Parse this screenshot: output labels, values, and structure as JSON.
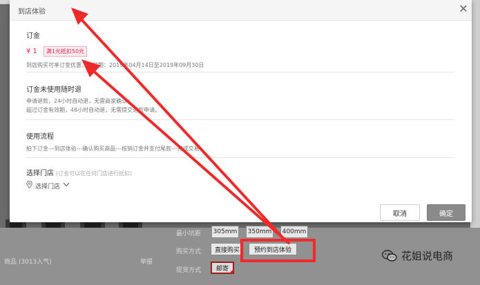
{
  "colors": {
    "accent_red": "#e0244a",
    "annotation_red": "#ef2a2a",
    "confirm_gray": "#8a8a8a"
  },
  "modal": {
    "title": "到店体验",
    "close_icon": "close-icon",
    "deposit": {
      "title": "订金",
      "price": "¥ 1",
      "coupon": "满1元抵扣50元",
      "desc": "到店购买可享订金优惠，有效期：2019年04月14日至2019年09月30日"
    },
    "refund": {
      "title": "订金未使用随时退",
      "line1": "申请退款，24小时自动退，无需商家确认；",
      "line2": "超过订金有效期，48小时自动退，无需提交退款申请。"
    },
    "process": {
      "title": "使用流程",
      "desc": "拍下订金---到店体验---确认购买商品---核销订金并支付尾款---完成交易"
    },
    "store": {
      "title": "选择门店",
      "hint": "(订金可以在任何门店进行抵扣)",
      "select_label": "选择门店",
      "pin_icon": "location-pin-icon",
      "chevron_icon": "chevron-down-icon"
    },
    "cancel_label": "取消",
    "confirm_label": "确定"
  },
  "background": {
    "min_pitch_label": "最小坑距",
    "pitch_options": [
      "305mm",
      "350mm",
      "400mm"
    ],
    "purchase_label": "购买方式",
    "purchase_options": [
      "直接购买",
      "预约到店体验"
    ],
    "delivery_label": "提货方式",
    "delivery_option": "邮寄",
    "item_label": "商品 (3013人气)",
    "report_label": "举报"
  },
  "watermark": {
    "text": "花姐说电商",
    "icon": "wechat-icon"
  }
}
